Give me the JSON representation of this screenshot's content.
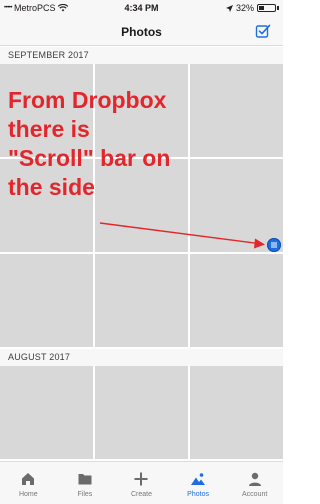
{
  "status_bar": {
    "signal": "•••••",
    "carrier": "MetroPCS",
    "time": "4:34 PM",
    "battery_text": "32%",
    "battery_level": 0.32
  },
  "nav": {
    "title": "Photos"
  },
  "sections": [
    {
      "header": "SEPTEMBER 2017"
    },
    {
      "header": "AUGUST 2017"
    }
  ],
  "annotation": {
    "lines": [
      "From Dropbox",
      "there is",
      "\"Scroll\" bar on",
      "the side"
    ],
    "color": "#e3262c"
  },
  "tabs": [
    {
      "label": "Home",
      "icon": "home-icon"
    },
    {
      "label": "Files",
      "icon": "folder-icon"
    },
    {
      "label": "Create",
      "icon": "plus-icon"
    },
    {
      "label": "Photos",
      "icon": "photos-icon",
      "active": true
    },
    {
      "label": "Account",
      "icon": "person-icon"
    }
  ],
  "colors": {
    "accent": "#1d6fe0",
    "placeholder": "#d8d8d8",
    "bar_background": "#f7f7f7"
  }
}
